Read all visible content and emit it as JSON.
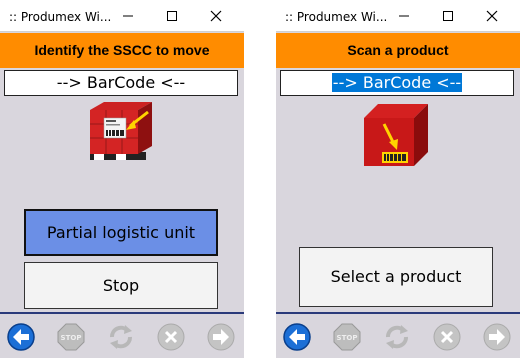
{
  "left_window": {
    "title": ":: Produmex Wi...",
    "header": "Identify the SSCC to move",
    "barcode_text": "--> BarCode <--",
    "image": "pallet-barcode-image",
    "buttons": {
      "partial_label": "Partial logistic unit",
      "stop_label": "Stop"
    }
  },
  "right_window": {
    "title": ":: Produmex Wi...",
    "header": "Scan a product",
    "barcode_text": "--> BarCode <--",
    "image": "box-barcode-image",
    "buttons": {
      "select_label": "Select a product"
    }
  },
  "toolbar": {
    "icons": [
      "back-arrow-icon",
      "stop-sign-icon",
      "refresh-icon",
      "cancel-icon",
      "forward-arrow-icon"
    ]
  },
  "colors": {
    "header_orange": "#ff8c00",
    "primary_button": "#6b8fe6",
    "background": "#d9d6dd",
    "selection_blue": "#0078d7"
  }
}
